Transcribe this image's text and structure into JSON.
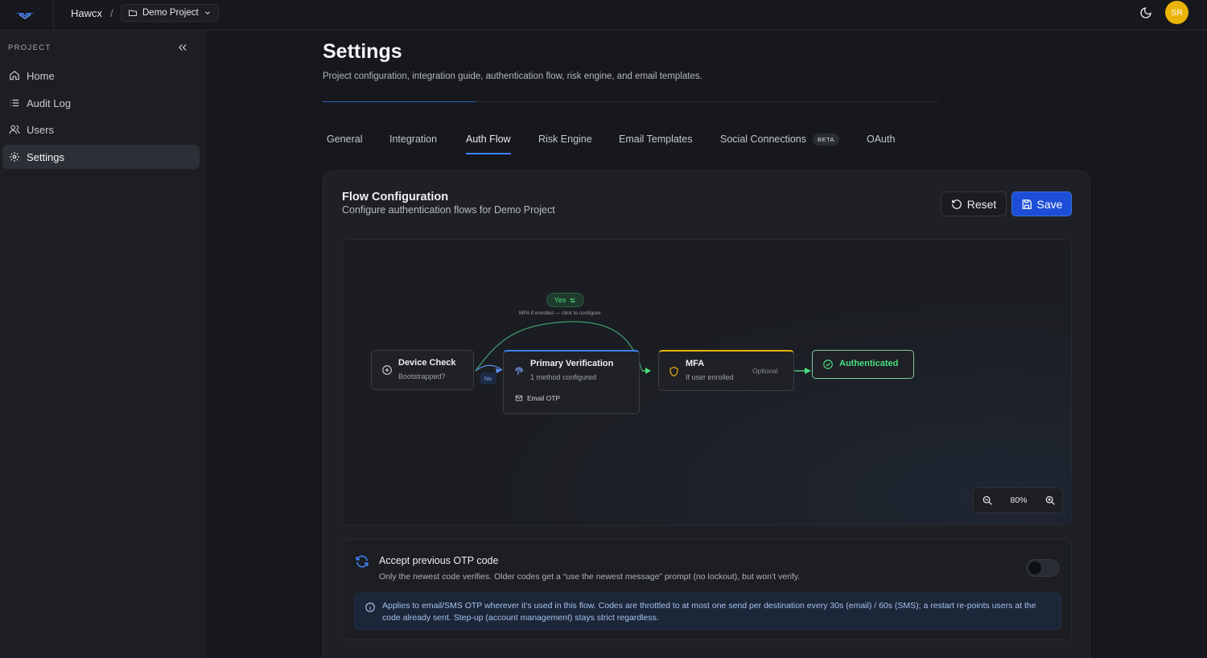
{
  "header": {
    "brand": "Hawcx",
    "separator": "/",
    "project": "Demo Project",
    "avatar_initials": "SR"
  },
  "sidebar": {
    "heading": "PROJECT",
    "items": [
      {
        "label": "Home",
        "icon": "home-icon"
      },
      {
        "label": "Audit Log",
        "icon": "list-icon"
      },
      {
        "label": "Users",
        "icon": "users-icon"
      },
      {
        "label": "Settings",
        "icon": "gear-icon",
        "active": true
      }
    ]
  },
  "page": {
    "title": "Settings",
    "subtitle": "Project configuration, integration guide, authentication flow, risk engine, and email templates."
  },
  "tabs": [
    {
      "label": "General"
    },
    {
      "label": "Integration"
    },
    {
      "label": "Auth Flow",
      "active": true
    },
    {
      "label": "Risk Engine"
    },
    {
      "label": "Email Templates"
    },
    {
      "label": "Social Connections",
      "badge": "BETA"
    },
    {
      "label": "OAuth"
    }
  ],
  "flow": {
    "title": "Flow Configuration",
    "subtitle": "Configure authentication flows for Demo Project",
    "reset_label": "Reset",
    "save_label": "Save",
    "nodes": {
      "device_check": {
        "title": "Device Check",
        "subtitle": "Bootstrapped?"
      },
      "primary": {
        "title": "Primary Verification",
        "subtitle": "1 method configured",
        "method": "Email OTP"
      },
      "mfa": {
        "title": "MFA",
        "subtitle": "If user enrolled",
        "badge": "Optional"
      },
      "authenticated": {
        "title": "Authenticated"
      }
    },
    "yes_label": "Yes",
    "yes_note": "MFA if enrolled — click to configure",
    "no_label": "No",
    "zoom": "80%"
  },
  "otp": {
    "title": "Accept previous OTP code",
    "subtitle": "Only the newest code verifies. Older codes get a “use the newest message” prompt (no lockout), but won’t verify.",
    "enabled": false,
    "info": "Applies to email/SMS OTP wherever it’s used in this flow. Codes are throttled to at most one send per destination every 30s (email) / 60s (SMS); a restart re-points users at the code already sent. Step-up (account management) stays strict regardless."
  },
  "colors": {
    "accent": "#3b82f6",
    "save_button": "#1d4ed8",
    "avatar": "#eab308",
    "success": "#4ade80",
    "warning": "#eab308"
  }
}
